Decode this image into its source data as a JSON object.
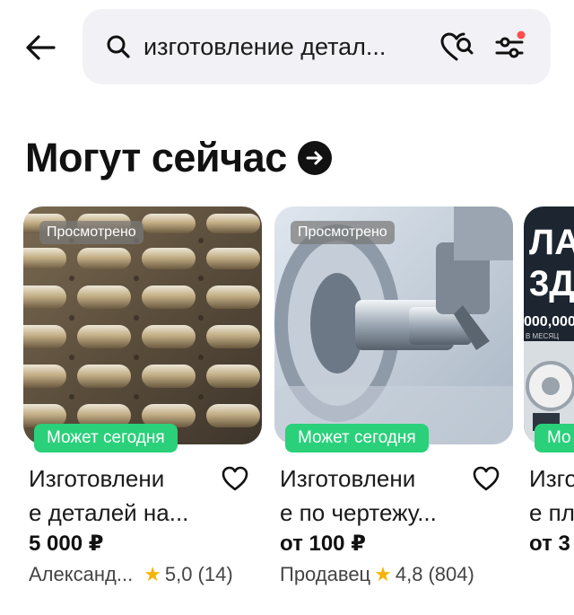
{
  "header": {
    "search_text": "изготовление детал...",
    "icons": [
      "back-arrow-icon",
      "search-icon",
      "heart-search-icon",
      "filter-icon"
    ],
    "filter_dot_color": "#ff4d4d"
  },
  "section": {
    "title": "Могут сейчас"
  },
  "cards": [
    {
      "viewed": "Просмотрено",
      "badge": "Может сегодня",
      "title_line1": "Изготовлени",
      "title_line2": "е деталей на...",
      "price": "5 000 ₽",
      "seller": "Александ...",
      "rating": "5,0",
      "reviews": "(14)"
    },
    {
      "viewed": "Просмотрено",
      "badge": "Может сегодня",
      "title_line1": "Изготовлени",
      "title_line2": "е по чертежу...",
      "price": "от 100 ₽",
      "seller": "Продавец",
      "rating": "4,8",
      "reviews": "(804)"
    },
    {
      "badge": "Мо",
      "title_line1": "Изго",
      "title_line2": "е пл",
      "price": "от 3",
      "img_text_1": "ЛА",
      "img_text_2": "3Д",
      "img_text_3": "000,000",
      "img_text_4": "В МЕСЯЦ"
    }
  ],
  "colors": {
    "badge_green": "#2ad07a",
    "star": "#f5b400",
    "search_bg": "#f2f1f5"
  }
}
